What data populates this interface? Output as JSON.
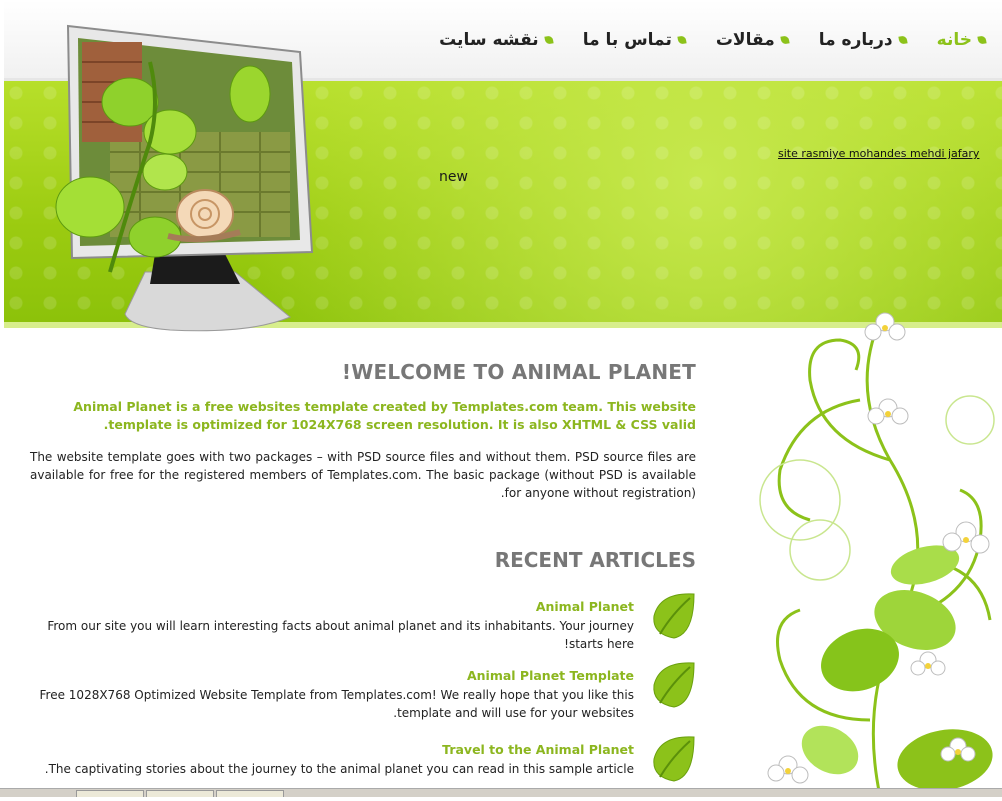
{
  "nav": {
    "items": [
      {
        "label": "خانه",
        "active": true
      },
      {
        "label": "درباره ما",
        "active": false
      },
      {
        "label": "مقالات",
        "active": false
      },
      {
        "label": "تماس با ما",
        "active": false
      },
      {
        "label": "نقشه سایت",
        "active": false
      }
    ]
  },
  "banner": {
    "new_label": "new",
    "site_link": "site rasmiye mohandes mehdi jafary"
  },
  "welcome": {
    "title": "WELCOME TO ANIMAL PLANET!",
    "intro": "Animal Planet is a free websites template created by Templates.com team. This website template is optimized for 1024X768 screen resolution. It is also XHTML & CSS valid.",
    "description": "The website template goes with two packages – with PSD source files and without them. PSD source files are available for free for the registered members of Templates.com. The basic package (without PSD is available for anyone without registration)."
  },
  "recent": {
    "title": "RECENT ARTICLES",
    "articles": [
      {
        "title": "Animal Planet",
        "body": "From our site you will learn interesting facts about animal planet and its inhabitants. Your journey starts here!"
      },
      {
        "title": "Animal Planet Template",
        "body": "Free 1028X768 Optimized Website Template from Templates.com! We really hope that you like this template and will use for your websites."
      },
      {
        "title": "Travel to the Animal Planet",
        "body": "The captivating stories about the journey to the animal planet you can read in this sample article."
      }
    ]
  },
  "colors": {
    "accent": "#8cc21a",
    "heading": "#777777",
    "banner_green": "#9bcb10"
  }
}
